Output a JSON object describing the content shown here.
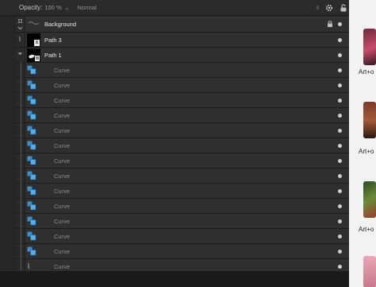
{
  "toolbar": {
    "opacity_label": "Opacity:",
    "opacity_value": "100 %",
    "blend_mode": "Normal"
  },
  "layers": {
    "background": {
      "name": "Background"
    },
    "path3": {
      "name": "Path 3"
    },
    "path1": {
      "name": "Path 1"
    },
    "curves": [
      "Curve",
      "Curve",
      "Curve",
      "Curve",
      "Curve",
      "Curve",
      "Curve",
      "Curve",
      "Curve",
      "Curve",
      "Curve",
      "Curve",
      "Curve",
      "Curve"
    ]
  },
  "right_panel": {
    "labels": [
      "Art+o",
      "Art+o",
      "Art+o"
    ]
  },
  "colors": {
    "panel_bg": "#262626",
    "row_bg": "#303030",
    "curve_icon_blue": "#3a8fd0",
    "visibility_dot": "#cfcfcf"
  }
}
